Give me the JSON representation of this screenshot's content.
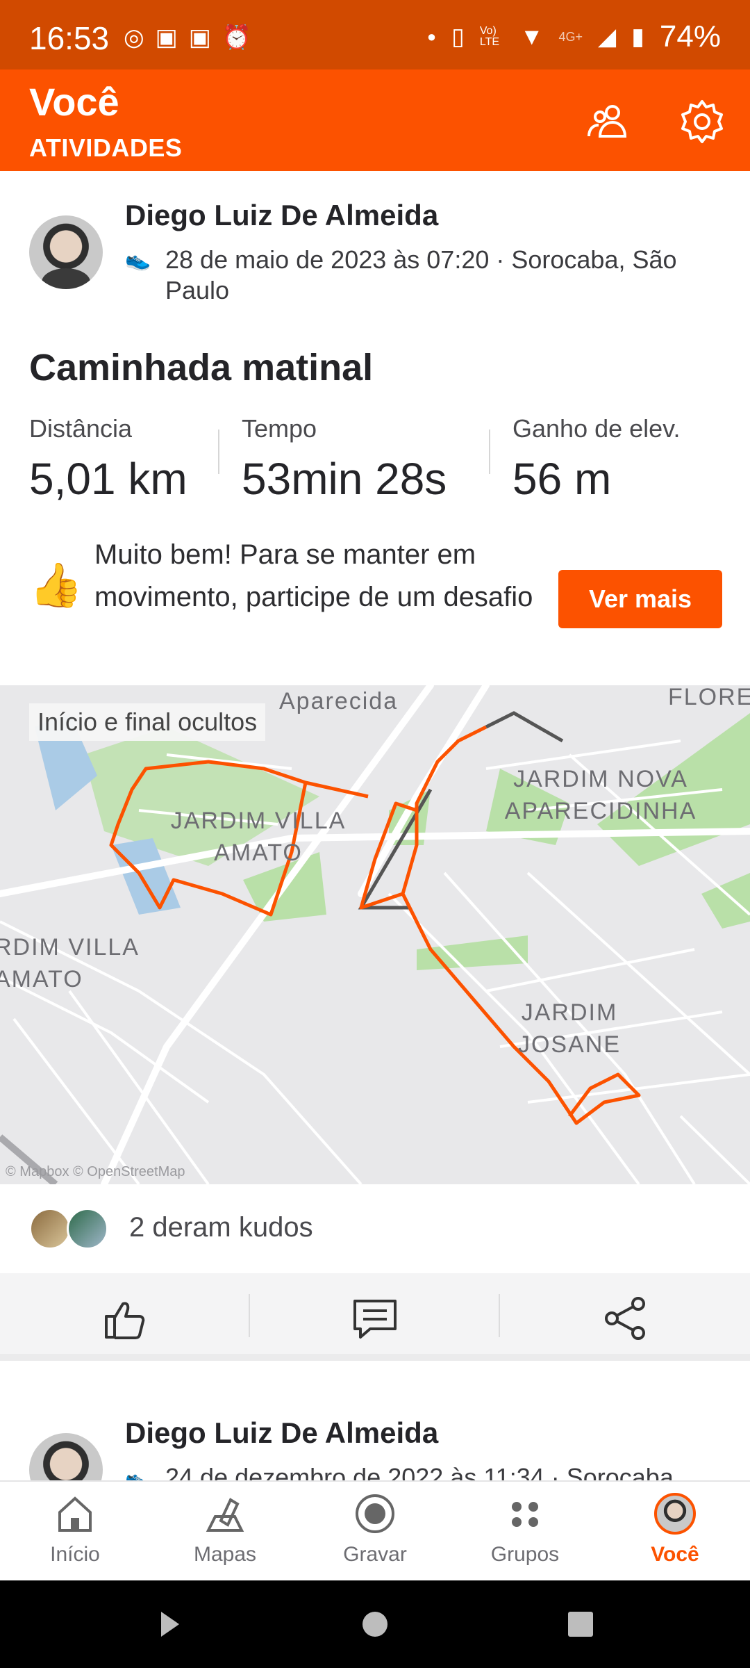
{
  "status_bar": {
    "time": "16:53",
    "battery": "74%",
    "network": "4G+",
    "volte": "Vo) LTE"
  },
  "app_bar": {
    "title": "Você",
    "subtitle": "ATIVIDADES"
  },
  "activity": {
    "author": "Diego Luiz De Almeida",
    "meta": "28 de maio de 2023 às 07:20 · Sorocaba, São Paulo",
    "title": "Caminhada matinal",
    "stats": [
      {
        "label": "Distância",
        "value": "5,01 km"
      },
      {
        "label": "Tempo",
        "value": "53min 28s"
      },
      {
        "label": "Ganho de elev.",
        "value": "56 m"
      }
    ],
    "challenge_text": "Muito bem! Para se manter em movimento, participe de um desafio",
    "challenge_button": "Ver mais",
    "map": {
      "hidden_label": "Início e final ocultos",
      "places": [
        "Aparecida",
        "FLORE",
        "JARDIM NOVA APARECIDINHA",
        "JARDIM VILLA AMATO",
        "RDIM VILLA AMATO",
        "JARDIM JOSANE"
      ],
      "attribution": "© Mapbox © OpenStreetMap",
      "route_color": "#fc5200"
    },
    "kudos_text": "2 deram kudos",
    "actions": [
      "thumbs-up-icon",
      "comment-icon",
      "share-icon"
    ]
  },
  "next_activity": {
    "author": "Diego Luiz De Almeida",
    "meta": "24 de dezembro de 2022 às 11:34 · Sorocaba"
  },
  "bottom_nav": [
    {
      "label": "Início",
      "icon": "home-icon"
    },
    {
      "label": "Mapas",
      "icon": "map-icon"
    },
    {
      "label": "Gravar",
      "icon": "record-icon"
    },
    {
      "label": "Grupos",
      "icon": "groups-icon"
    },
    {
      "label": "Você",
      "icon": "profile-avatar-icon",
      "active": true
    }
  ],
  "colors": {
    "brand": "#fc5200",
    "status_bar": "#d14a00"
  }
}
